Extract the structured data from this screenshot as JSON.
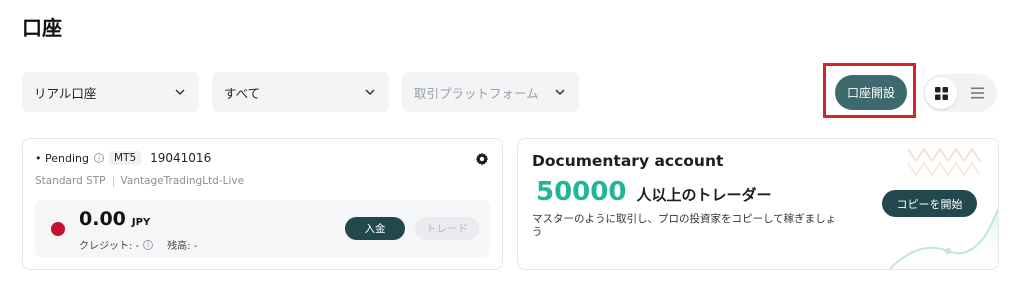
{
  "page": {
    "title": "口座"
  },
  "filters": {
    "account_type": {
      "value": "リアル口座"
    },
    "status": {
      "value": "すべて"
    },
    "platform": {
      "placeholder": "取引プラットフォーム"
    }
  },
  "header_actions": {
    "open_account_label": "口座開設",
    "views": [
      "grid",
      "list"
    ]
  },
  "account_card": {
    "status": "• Pending",
    "platform_tag": "MT5",
    "account_number": "19041016",
    "account_type": "Standard STP",
    "server": "VantageTradingLtd-Live",
    "balance": "0.00",
    "currency": "JPY",
    "credit_label": "クレジット: -",
    "balance_label": "残高: -",
    "deposit_label": "入金",
    "trade_label": "トレード"
  },
  "promo_card": {
    "title": "Documentary account",
    "count": "50000",
    "count_suffix": "人以上のトレーダー",
    "description": "マスターのように取引し、プロの投資家をコピーして稼ぎましょう",
    "button_label": "コピーを開始"
  },
  "colors": {
    "primary_button": "#3d6b6d",
    "dark_button": "#22474d",
    "accent_green": "#21b59a",
    "highlight_border": "#d3262a",
    "flag_red": "#bf1331"
  }
}
